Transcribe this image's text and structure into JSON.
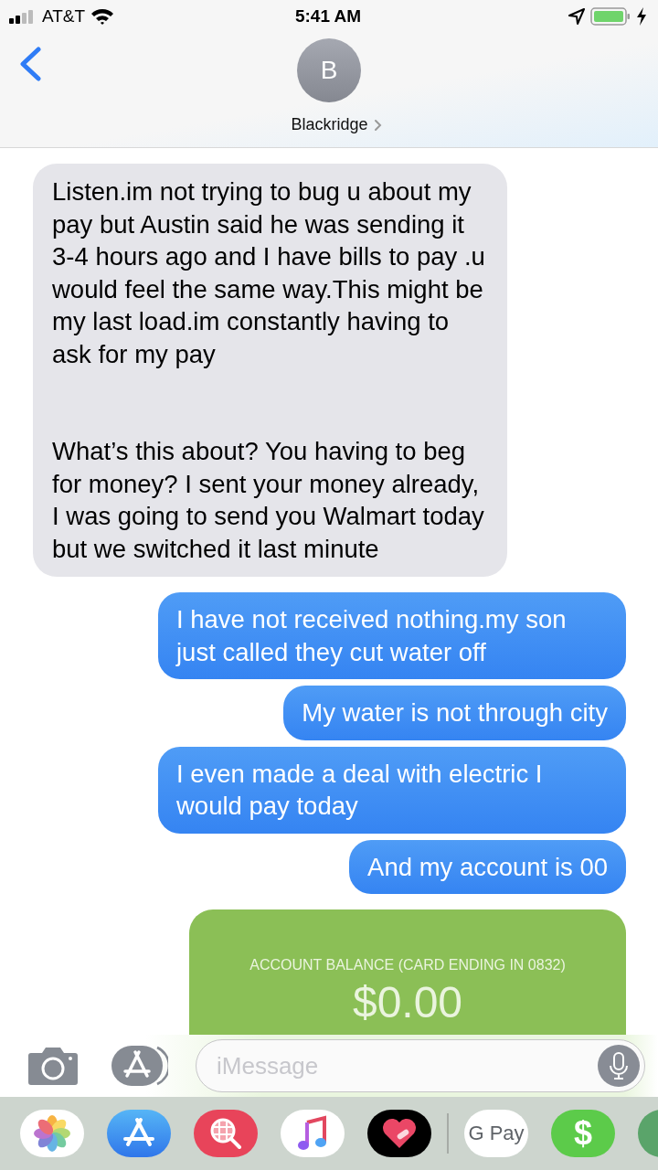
{
  "status_bar": {
    "carrier": "AT&T",
    "time": "5:41 AM"
  },
  "contact": {
    "initial": "B",
    "name": "Blackridge"
  },
  "messages": [
    {
      "kind": "received",
      "paragraphs": [
        "Listen.im not trying to bug u about my pay but Austin said he was sending it 3-4 hours ago and I have bills to pay .u would feel the same way.This might be my last load.im constantly having to ask for my pay",
        "What’s this about? You having to beg for money? I sent your money already, I was going to send you Walmart today but we switched it last minute"
      ]
    },
    {
      "kind": "sent",
      "text": "I have not received nothing.my son just called they cut water off"
    },
    {
      "kind": "sent",
      "text": "My water is not through city"
    },
    {
      "kind": "sent",
      "text": "I even made a deal with electric I would pay today"
    },
    {
      "kind": "sent",
      "text": "And my account is 00"
    },
    {
      "kind": "card",
      "label": "ACCOUNT BALANCE (CARD ENDING IN 0832)",
      "amount": "$0.00"
    }
  ],
  "composer": {
    "placeholder": "iMessage"
  },
  "dock": [
    {
      "kind": "photos"
    },
    {
      "kind": "appstore"
    },
    {
      "kind": "search"
    },
    {
      "kind": "music"
    },
    {
      "kind": "heart"
    },
    {
      "kind": "divider"
    },
    {
      "kind": "gpay",
      "text": "G Pay"
    },
    {
      "kind": "cash",
      "text": "$"
    },
    {
      "kind": "maps"
    }
  ]
}
